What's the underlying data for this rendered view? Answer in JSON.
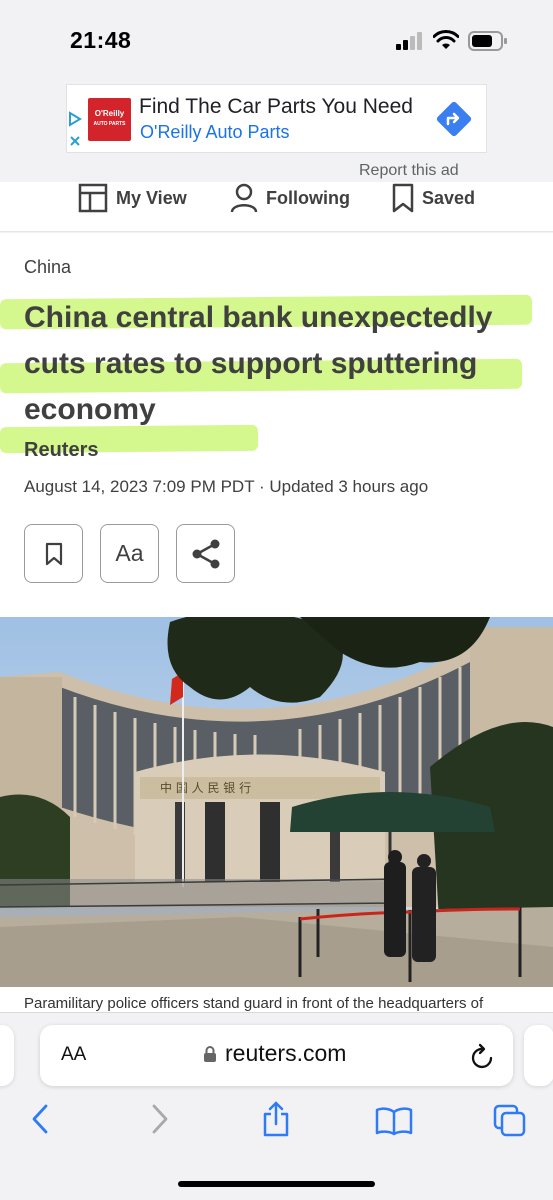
{
  "status_bar": {
    "time": "21:48"
  },
  "ad": {
    "logo_text": "O'Reilly",
    "logo_sub": "AUTO PARTS",
    "title": "Find The Car Parts You Need",
    "advertiser": "O'Reilly Auto Parts",
    "report_label": "Report this ad"
  },
  "nav": {
    "my_view": "My View",
    "following": "Following",
    "saved": "Saved"
  },
  "article": {
    "category": "China",
    "headline": "China central bank unexpectedly cuts rates to support sputtering economy",
    "byline": "Reuters",
    "dateline": "August 14, 2023 7:09 PM PDT · Updated 3 hours ago",
    "font_size_label": "Aa",
    "highlight_color": "#cdf67a",
    "image_sign_text": "中 国 人 民 银 行",
    "caption": "Paramilitary police officers stand guard in front of the headquarters of"
  },
  "browser": {
    "text_size_label": "AA",
    "url": "reuters.com",
    "accent_color": "#2f7bf6"
  },
  "icons": {
    "status": [
      "signal-icon",
      "wifi-icon",
      "battery-icon"
    ],
    "toolbar": [
      "back-icon",
      "forward-icon",
      "share-icon",
      "bookmarks-icon",
      "tabs-icon"
    ]
  }
}
